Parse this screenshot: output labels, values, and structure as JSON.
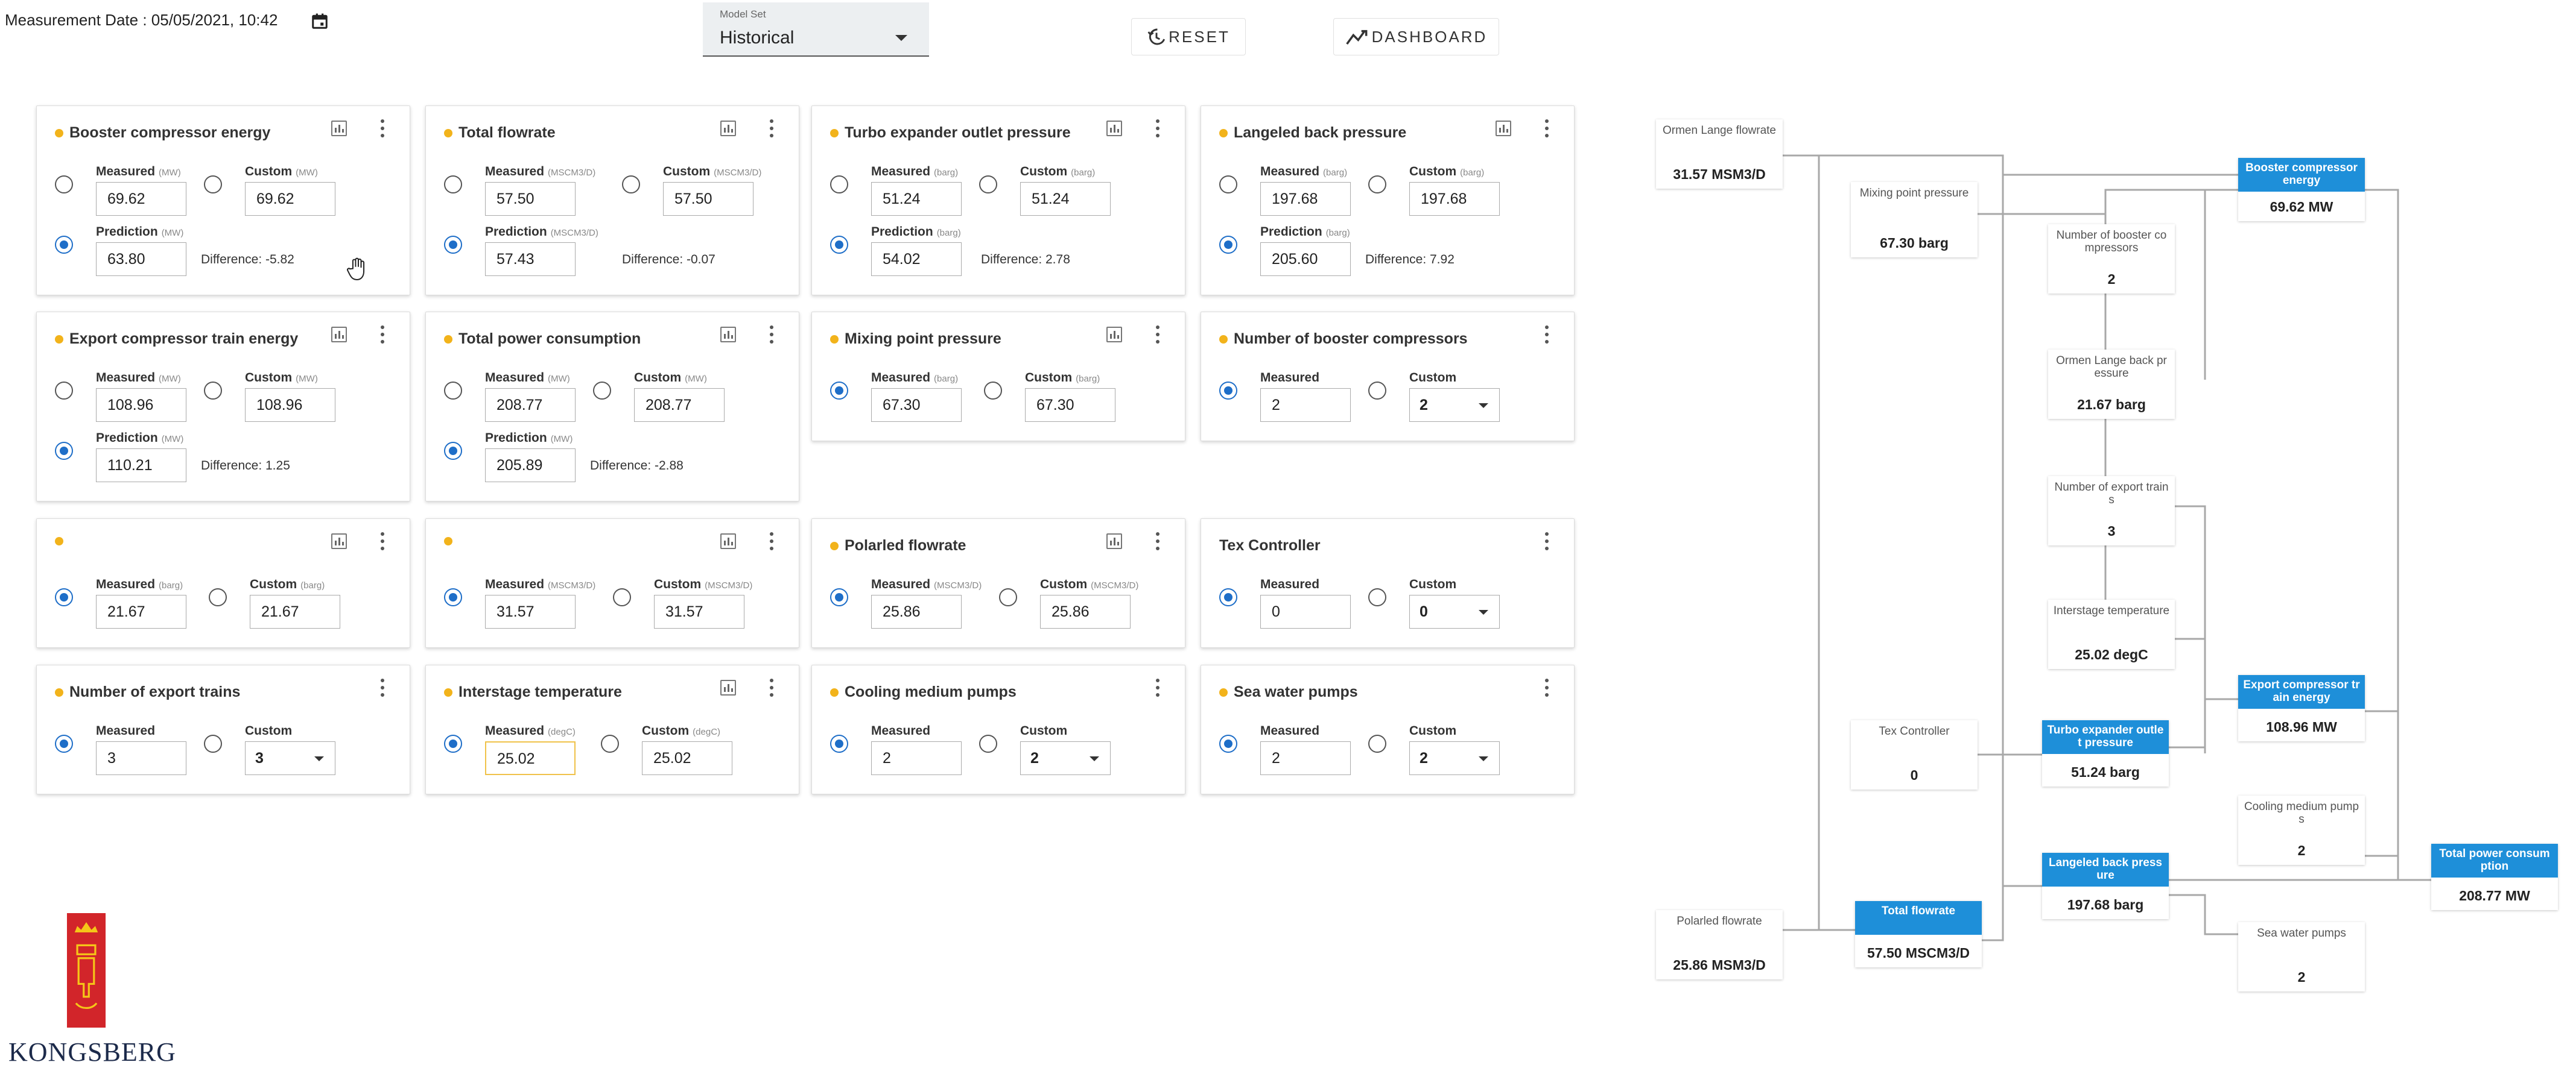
{
  "header": {
    "measurement_date": "Measurement Date : 05/05/2021, 10:42",
    "model_set_label": "Model Set",
    "model_set_value": "Historical",
    "reset_label": "RESET",
    "dashboard_label": "DASHBOARD"
  },
  "labels": {
    "measured": "Measured",
    "custom": "Custom",
    "prediction": "Prediction"
  },
  "cards": {
    "booster": {
      "title": "Booster compressor energy",
      "unit": "(MW)",
      "measured": "69.62",
      "custom": "69.62",
      "prediction": "63.80",
      "difference": "Difference: -5.82"
    },
    "flowrate": {
      "title": "Total flowrate",
      "unit": "(MSCM3/D)",
      "measured": "57.50",
      "custom": "57.50",
      "prediction": "57.43",
      "difference": "Difference: -0.07"
    },
    "turbo": {
      "title": "Turbo expander outlet pressure",
      "unit": "(barg)",
      "measured": "51.24",
      "custom": "51.24",
      "prediction": "54.02",
      "difference": "Difference: 2.78"
    },
    "langeled": {
      "title": "Langeled back pressure",
      "unit": "(barg)",
      "measured": "197.68",
      "custom": "197.68",
      "prediction": "205.60",
      "difference": "Difference: 7.92"
    },
    "export_energy": {
      "title": "Export compressor train energy",
      "unit": "(MW)",
      "measured": "108.96",
      "custom": "108.96",
      "prediction": "110.21",
      "difference": "Difference: 1.25"
    },
    "power": {
      "title": "Total power consumption",
      "unit": "(MW)",
      "measured": "208.77",
      "custom": "208.77",
      "prediction": "205.89",
      "difference": "Difference: -2.88"
    },
    "mixing": {
      "title": "Mixing point pressure",
      "unit": "(barg)",
      "measured": "67.30",
      "custom": "67.30"
    },
    "num_booster": {
      "title": "Number of booster compressors",
      "measured": "2",
      "custom": "2"
    },
    "blank1": {
      "title": "",
      "unit": "(barg)",
      "measured": "21.67",
      "custom": "21.67"
    },
    "blank2": {
      "title": "",
      "unit": "(MSCM3/D)",
      "measured": "31.57",
      "custom": "31.57"
    },
    "polarled": {
      "title": "Polarled flowrate",
      "unit": "(MSCM3/D)",
      "measured": "25.86",
      "custom": "25.86"
    },
    "tex": {
      "title": "Tex Controller",
      "measured": "0",
      "custom": "0"
    },
    "num_export": {
      "title": "Number of export trains",
      "measured": "3",
      "custom": "3"
    },
    "interstage": {
      "title": "Interstage temperature",
      "unit": "(degC)",
      "measured": "25.02",
      "custom": "25.02"
    },
    "cooling": {
      "title": "Cooling medium pumps",
      "measured": "2",
      "custom": "2"
    },
    "seawater": {
      "title": "Sea water pumps",
      "measured": "2",
      "custom": "2"
    }
  },
  "diagram": {
    "ormen_flow": {
      "title": "Ormen Lange flowrate",
      "value": "31.57 MSM3/D"
    },
    "mixing": {
      "title": "Mixing point pressure",
      "value": "67.30 barg"
    },
    "num_booster": {
      "title": "Number of booster compressors",
      "value": "2"
    },
    "ormen_back": {
      "title": "Ormen Lange back pressure",
      "value": "21.67 barg"
    },
    "booster_energy": {
      "title": "Booster compressor energy",
      "value": "69.62 MW"
    },
    "num_export": {
      "title": "Number of export trains",
      "value": "3"
    },
    "interstage": {
      "title": "Interstage temperature",
      "value": "25.02 degC"
    },
    "tex": {
      "title": "Tex Controller",
      "value": "0"
    },
    "turbo": {
      "title": "Turbo expander outlet pressure",
      "value": "51.24 barg"
    },
    "export_energy": {
      "title": "Export compressor train energy",
      "value": "108.96 MW"
    },
    "cooling": {
      "title": "Cooling medium pumps",
      "value": "2"
    },
    "langeled": {
      "title": "Langeled back pressure",
      "value": "197.68 barg"
    },
    "total_power": {
      "title": "Total power consumption",
      "value": "208.77 MW"
    },
    "polarled": {
      "title": "Polarled flowrate",
      "value": "25.86 MSM3/D"
    },
    "total_flow": {
      "title": "Total flowrate",
      "value": "57.50 MSCM3/D"
    },
    "seawater": {
      "title": "Sea water pumps",
      "value": "2"
    }
  },
  "logo": {
    "text": "KONGSBERG"
  },
  "colors": {
    "accent_blue": "#1e8fd9",
    "radio_blue": "#1e6ec8",
    "status_dot": "#f2b31b"
  }
}
